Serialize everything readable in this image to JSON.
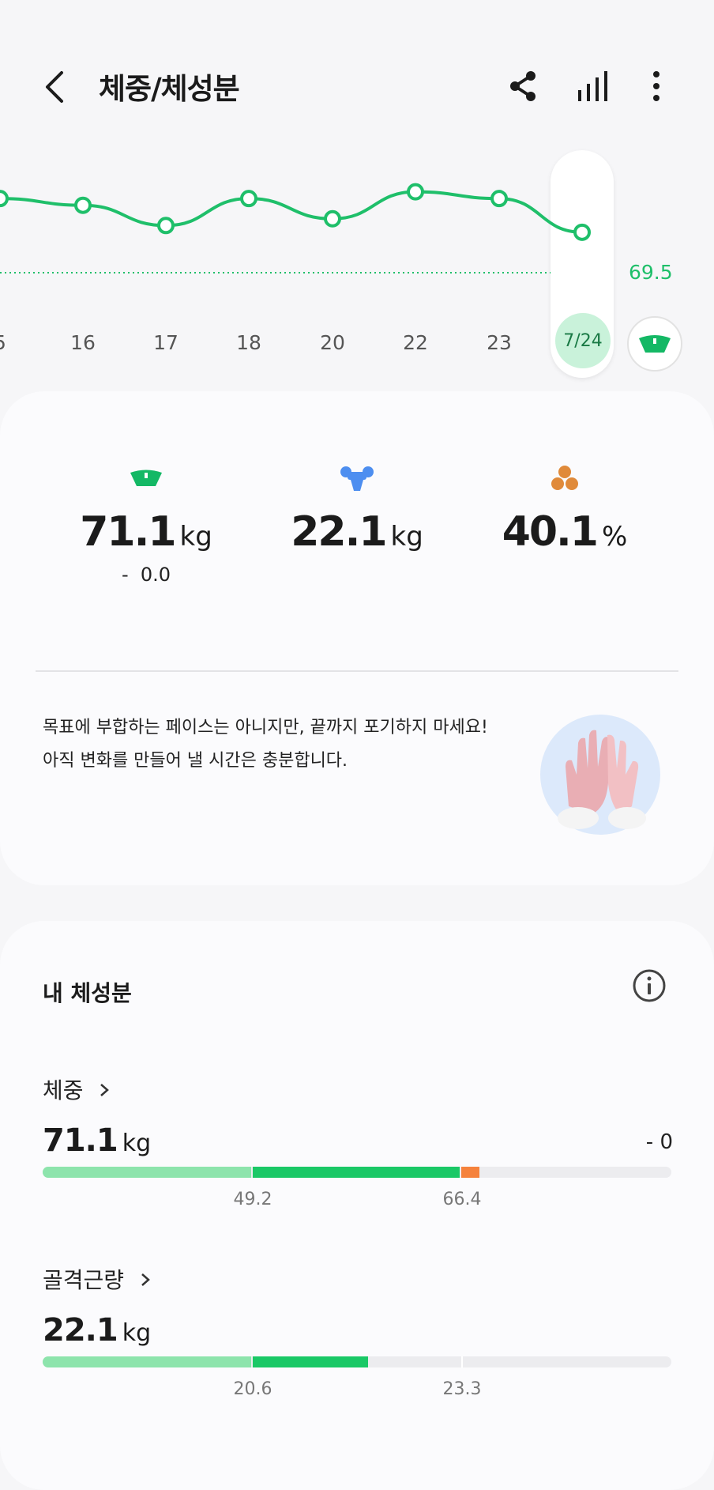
{
  "header": {
    "title": "체중/체성분",
    "back_icon": "chevron-left-icon",
    "share_icon": "share-icon",
    "stats_icon": "signal-bars-icon",
    "more_icon": "more-vertical-icon"
  },
  "chart_data": {
    "type": "line",
    "x": [
      "5",
      "16",
      "17",
      "18",
      "20",
      "22",
      "23",
      "7/24"
    ],
    "series": [
      {
        "values": [
          70.6,
          70.5,
          70.2,
          70.6,
          70.3,
          70.7,
          70.6,
          70.1
        ]
      }
    ],
    "target": {
      "value": "69.5"
    },
    "selected": "7/24",
    "colors": {
      "line": "#1fbf6a",
      "target": "#1fbf6a",
      "selected_bg": "#c9f2da"
    }
  },
  "summary": {
    "weight": {
      "icon": "scale-icon",
      "value": "71.1",
      "unit": "kg",
      "change": "-  0.0",
      "color": "#14b865"
    },
    "muscle": {
      "icon": "muscle-icon",
      "value": "22.1",
      "unit": "kg",
      "color": "#4d8ef0"
    },
    "fat": {
      "icon": "body-fat-icon",
      "value": "40.1",
      "unit": "%",
      "color": "#e08a3a"
    },
    "message_line1": "목표에 부합하는 페이스는 아니지만, 끝까지 포기하지 마세요!",
    "message_line2": "아직 변화를 만들어 낼 시간은 충분합니다."
  },
  "composition": {
    "title": "내 체성분",
    "info_icon": "info-icon",
    "weight": {
      "label": "체중",
      "value": "71.1",
      "unit": "kg",
      "change": "- 0",
      "ticks": [
        "49.2",
        "66.4"
      ]
    },
    "muscle": {
      "label": "골격근량",
      "value": "22.1",
      "unit": "kg",
      "ticks": [
        "20.6",
        "23.3"
      ]
    }
  }
}
